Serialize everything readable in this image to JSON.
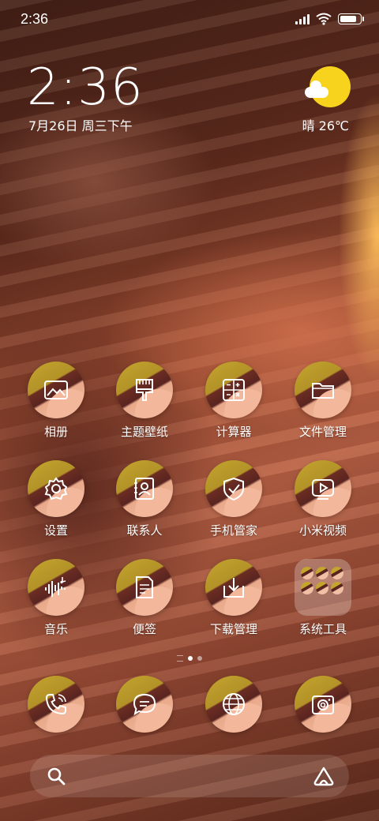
{
  "status_bar": {
    "time": "2:36",
    "battery_level": 0.9
  },
  "clock_widget": {
    "time": "2:36",
    "date": "7月26日 周三下午"
  },
  "weather": {
    "text": "晴 26℃",
    "sun_color": "#f7d31d"
  },
  "apps": [
    {
      "label": "相册",
      "icon": "gallery-icon"
    },
    {
      "label": "主题壁纸",
      "icon": "theme-brush-icon"
    },
    {
      "label": "计算器",
      "icon": "calculator-icon"
    },
    {
      "label": "文件管理",
      "icon": "folder-icon"
    },
    {
      "label": "设置",
      "icon": "gear-icon"
    },
    {
      "label": "联系人",
      "icon": "contacts-icon"
    },
    {
      "label": "手机管家",
      "icon": "security-shield-icon"
    },
    {
      "label": "小米视频",
      "icon": "video-play-icon"
    },
    {
      "label": "音乐",
      "icon": "music-icon"
    },
    {
      "label": "便签",
      "icon": "notes-icon"
    },
    {
      "label": "下载管理",
      "icon": "download-icon"
    },
    {
      "label": "系统工具",
      "icon": "system-tools-folder-icon"
    }
  ],
  "dock": [
    {
      "icon": "phone-icon"
    },
    {
      "icon": "messages-icon"
    },
    {
      "icon": "browser-globe-icon"
    },
    {
      "icon": "camera-icon"
    }
  ],
  "page_indicator": {
    "pages": 2,
    "current": 1
  },
  "search_bar": {
    "left_icon": "search-icon",
    "right_icon": "assistant-icon"
  }
}
